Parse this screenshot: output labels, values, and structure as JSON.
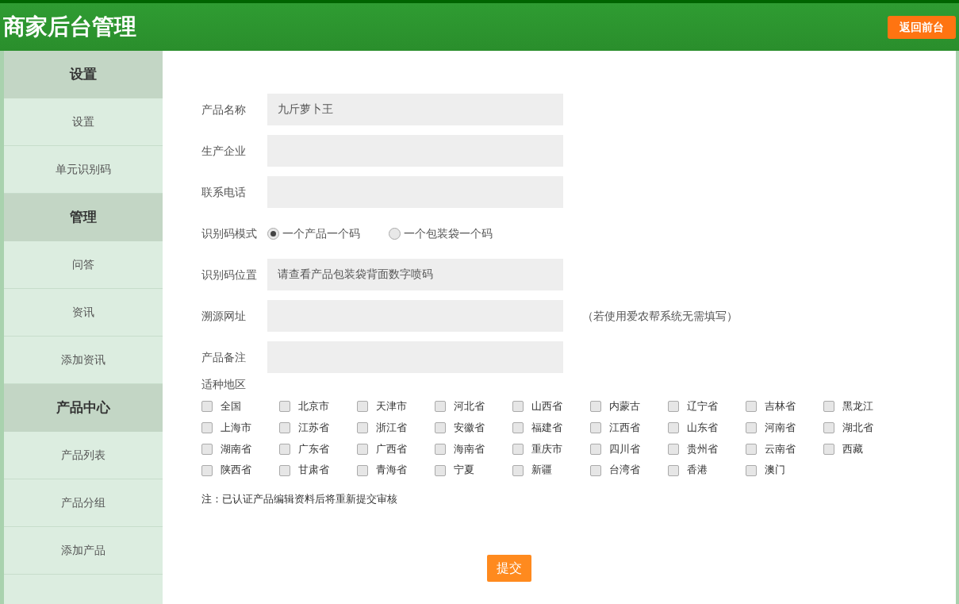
{
  "header": {
    "title": "商家后台管理",
    "back_button": "返回前台"
  },
  "sidebar": [
    {
      "heading": "设置",
      "items": [
        "设置",
        "单元识别码"
      ]
    },
    {
      "heading": "管理",
      "items": [
        "问答",
        "资讯",
        "添加资讯"
      ]
    },
    {
      "heading": "产品中心",
      "items": [
        "产品列表",
        "产品分组",
        "添加产品"
      ]
    }
  ],
  "form": {
    "fields": [
      {
        "label": "产品名称",
        "kind": "text",
        "value": "九斤萝卜王"
      },
      {
        "label": "生产企业",
        "kind": "text"
      },
      {
        "label": "联系电话",
        "kind": "text"
      },
      {
        "label": "识别码模式",
        "kind": "radio",
        "options": [
          {
            "label": "一个产品一个码",
            "selected": true
          },
          {
            "label": "一个包装袋一个码",
            "selected": false
          }
        ]
      },
      {
        "label": "识别码位置",
        "kind": "text",
        "value": "请查看产品包装袋背面数字喷码"
      },
      {
        "label": "溯源网址",
        "kind": "text",
        "hint": "（若使用爱农帮系统无需填写）"
      },
      {
        "label": "产品备注",
        "kind": "text"
      }
    ],
    "regions_label": "适种地区",
    "regions": [
      {
        "name": "全国",
        "checked": false
      },
      {
        "name": "北京市",
        "checked": false
      },
      {
        "name": "天津市",
        "checked": false
      },
      {
        "name": "河北省",
        "checked": false
      },
      {
        "name": "山西省",
        "checked": false
      },
      {
        "name": "内蒙古",
        "checked": false
      },
      {
        "name": "辽宁省",
        "checked": false
      },
      {
        "name": "吉林省",
        "checked": false
      },
      {
        "name": "黑龙江",
        "checked": false
      },
      {
        "name": "上海市",
        "checked": false
      },
      {
        "name": "江苏省",
        "checked": false
      },
      {
        "name": "浙江省",
        "checked": false
      },
      {
        "name": "安徽省",
        "checked": false
      },
      {
        "name": "福建省",
        "checked": false
      },
      {
        "name": "江西省",
        "checked": false
      },
      {
        "name": "山东省",
        "checked": false
      },
      {
        "name": "河南省",
        "checked": false
      },
      {
        "name": "湖北省",
        "checked": false
      },
      {
        "name": "湖南省",
        "checked": false
      },
      {
        "name": "广东省",
        "checked": false
      },
      {
        "name": "广西省",
        "checked": false
      },
      {
        "name": "海南省",
        "checked": false
      },
      {
        "name": "重庆市",
        "checked": false
      },
      {
        "name": "四川省",
        "checked": false
      },
      {
        "name": "贵州省",
        "checked": false
      },
      {
        "name": "云南省",
        "checked": false
      },
      {
        "name": "西藏",
        "checked": false
      },
      {
        "name": "陕西省",
        "checked": false
      },
      {
        "name": "甘肃省",
        "checked": false
      },
      {
        "name": "青海省",
        "checked": false
      },
      {
        "name": "宁夏",
        "checked": false
      },
      {
        "name": "新疆",
        "checked": false
      },
      {
        "name": "台湾省",
        "checked": false
      },
      {
        "name": "香港",
        "checked": false
      },
      {
        "name": "澳门",
        "checked": false
      }
    ],
    "note": "注：已认证产品编辑资料后将重新提交审核",
    "submit": "提交"
  }
}
